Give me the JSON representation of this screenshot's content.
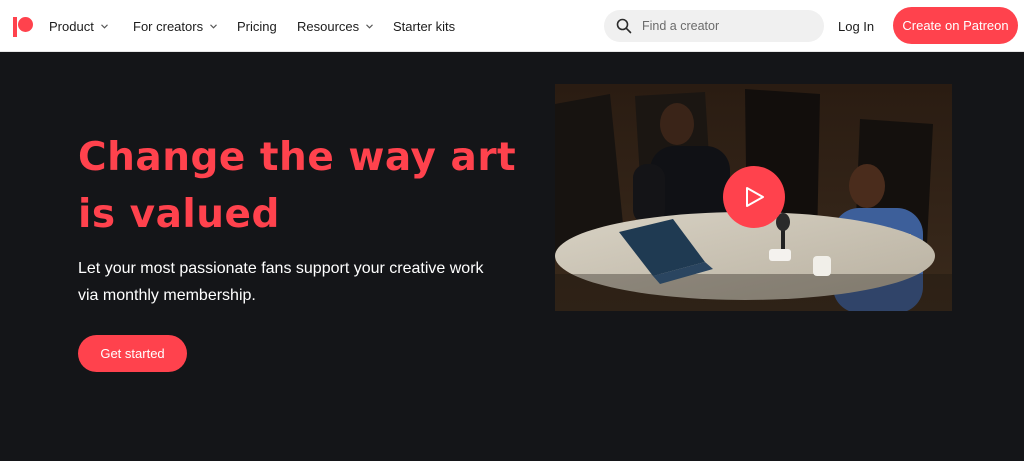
{
  "nav": {
    "items": [
      {
        "label": "Product",
        "has_dropdown": true
      },
      {
        "label": "For creators",
        "has_dropdown": true
      },
      {
        "label": "Pricing",
        "has_dropdown": false
      },
      {
        "label": "Resources",
        "has_dropdown": true
      },
      {
        "label": "Starter kits",
        "has_dropdown": false
      }
    ],
    "search": {
      "placeholder": "Find a creator",
      "value": "",
      "icon": "search-icon"
    },
    "login_label": "Log In",
    "cta_label": "Create on Patreon",
    "logo_icon": "patreon-logo-icon"
  },
  "hero": {
    "headline": "Change the way art is valued",
    "subtext": "Let your most passionate fans support your creative work via monthly membership.",
    "cta_label": "Get started",
    "video": {
      "play_icon": "play-icon"
    }
  },
  "colors": {
    "brand": "#ff424d",
    "hero_background": "#141518",
    "nav_background": "#ffffff",
    "search_background": "#f0f0f0"
  }
}
